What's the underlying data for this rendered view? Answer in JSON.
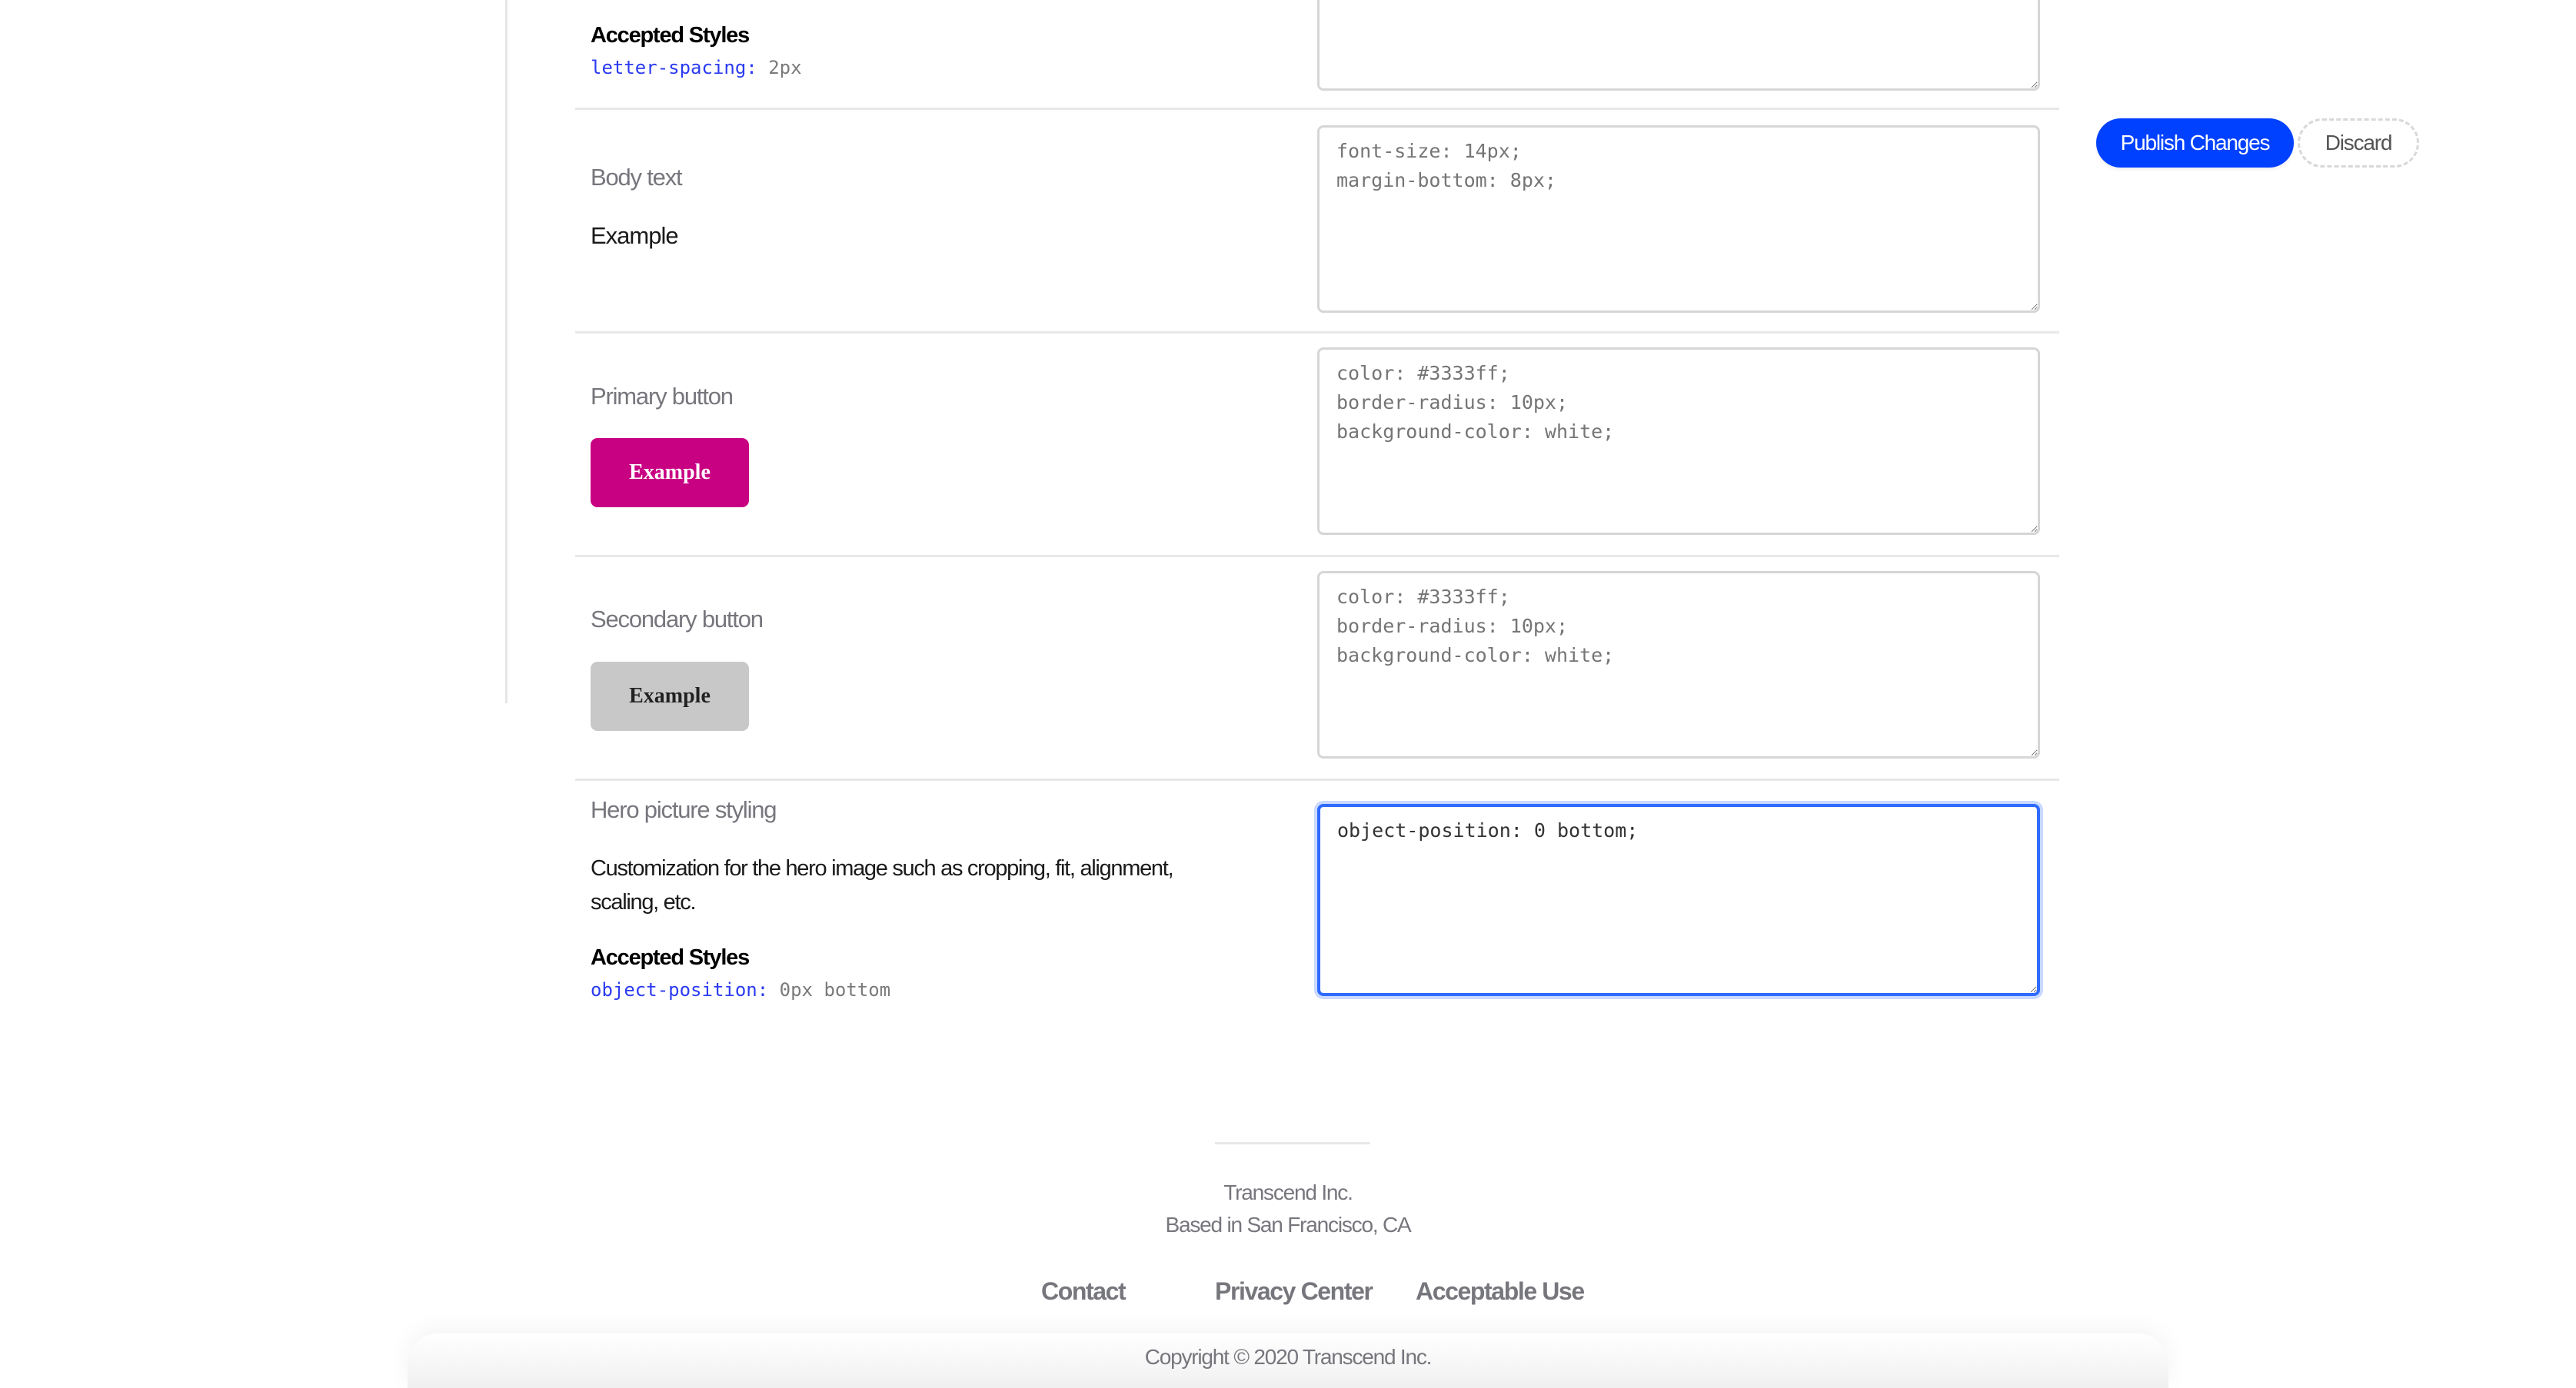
{
  "actions": {
    "publish_label": "Publish Changes",
    "discard_label": "Discard",
    "publish_color": "#0041ff"
  },
  "rows": [
    {
      "id": "letter-spacing-row",
      "accepted_title": "Accepted Styles",
      "accepted_prop": "letter-spacing:",
      "accepted_value": "2px",
      "textarea_value": ""
    },
    {
      "id": "body-text",
      "label": "Body text",
      "example": "Example",
      "textarea_placeholder": "font-size: 14px;\nmargin-bottom: 8px;"
    },
    {
      "id": "primary-button",
      "label": "Primary button",
      "example": "Example",
      "example_bg": "#c80082",
      "textarea_placeholder": "color: #3333ff;\nborder-radius: 10px;\nbackground-color: white;"
    },
    {
      "id": "secondary-button",
      "label": "Secondary button",
      "example": "Example",
      "example_bg": "#c8c8c8",
      "textarea_placeholder": "color: #3333ff;\nborder-radius: 10px;\nbackground-color: white;"
    },
    {
      "id": "hero-picture",
      "label": "Hero picture styling",
      "description": "Customization for the hero image such as cropping, fit, alignment, scaling, etc.",
      "accepted_title": "Accepted Styles",
      "accepted_prop": "object-position:",
      "accepted_value": "0px bottom",
      "textarea_value": "object-position: 0 bottom;"
    }
  ],
  "footer": {
    "company": "Transcend Inc.",
    "location": "Based in San Francisco, CA",
    "links": [
      "Contact",
      "Privacy Center",
      "Acceptable Use"
    ],
    "copyright": "Copyright © 2020 Transcend Inc."
  }
}
